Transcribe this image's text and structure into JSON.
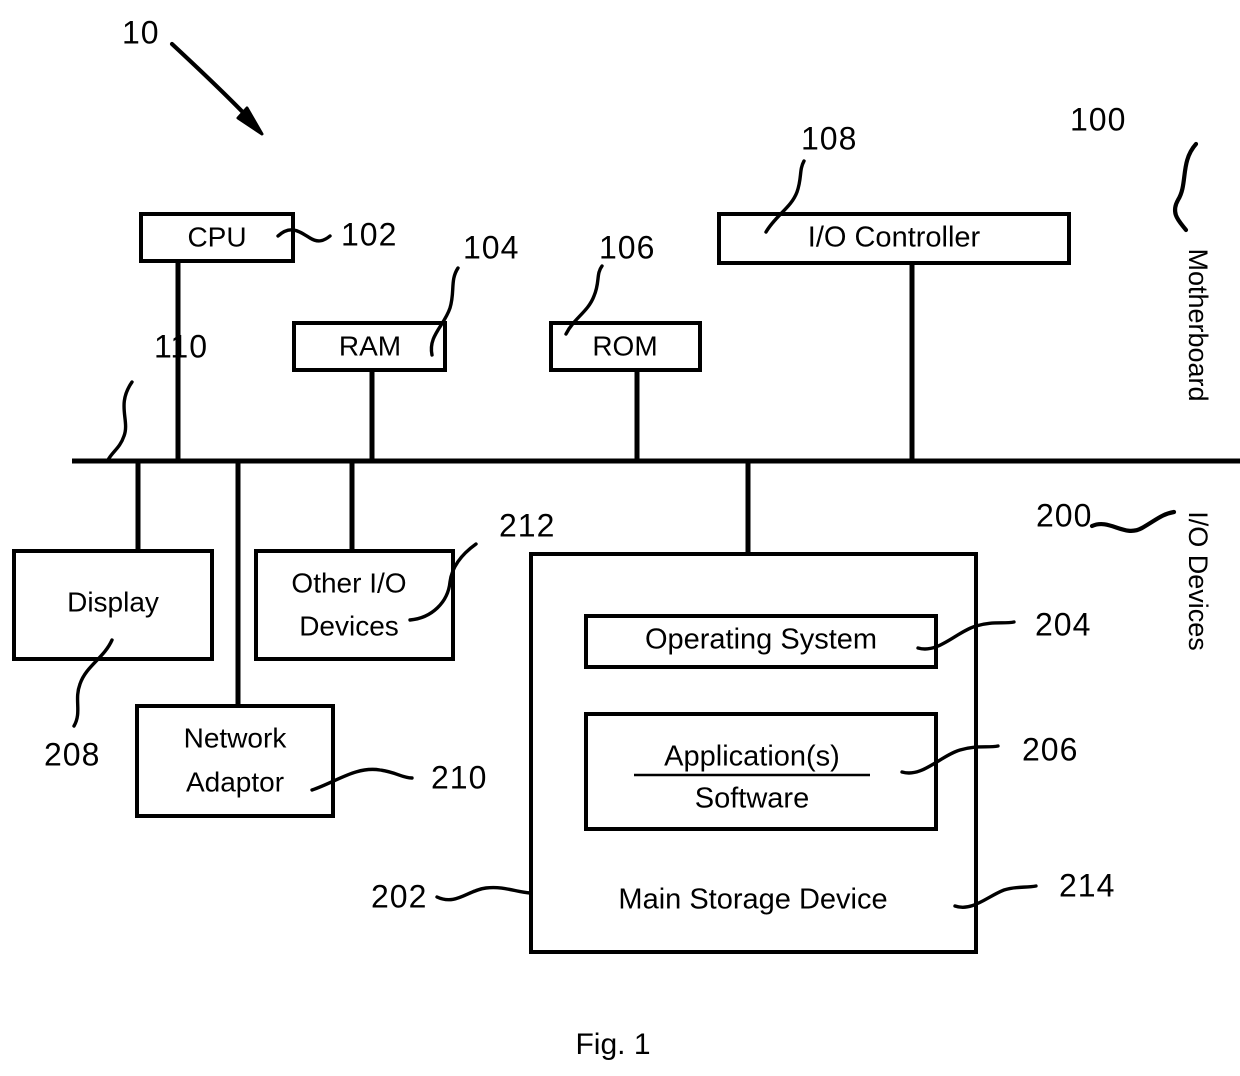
{
  "figure": {
    "caption": "Fig. 1",
    "system_ref": "10"
  },
  "sections": {
    "motherboard": {
      "label": "Motherboard",
      "ref": "100"
    },
    "io_devices": {
      "label": "I/O Devices",
      "ref": "200"
    },
    "bus": {
      "ref": "110"
    }
  },
  "blocks": {
    "cpu": {
      "label": "CPU",
      "ref": "102"
    },
    "ram": {
      "label": "RAM",
      "ref": "104"
    },
    "rom": {
      "label": "ROM",
      "ref": "106"
    },
    "io_controller": {
      "label": "I/O Controller",
      "ref": "108"
    },
    "display": {
      "label": "Display",
      "ref": "208"
    },
    "other_io": {
      "label_line1": "Other I/O",
      "label_line2": "Devices",
      "ref": "212"
    },
    "network_adaptor": {
      "label_line1": "Network",
      "label_line2": "Adaptor",
      "ref": "210"
    },
    "main_storage": {
      "label": "Main Storage Device",
      "ref": "202",
      "ref_alt": "214"
    },
    "operating_system": {
      "label": "Operating System",
      "ref": "204"
    },
    "applications": {
      "label_line1": "Application(s)",
      "label_line2": "Software",
      "ref": "206"
    }
  },
  "colors": {
    "stroke": "#000000",
    "background": "#ffffff"
  }
}
